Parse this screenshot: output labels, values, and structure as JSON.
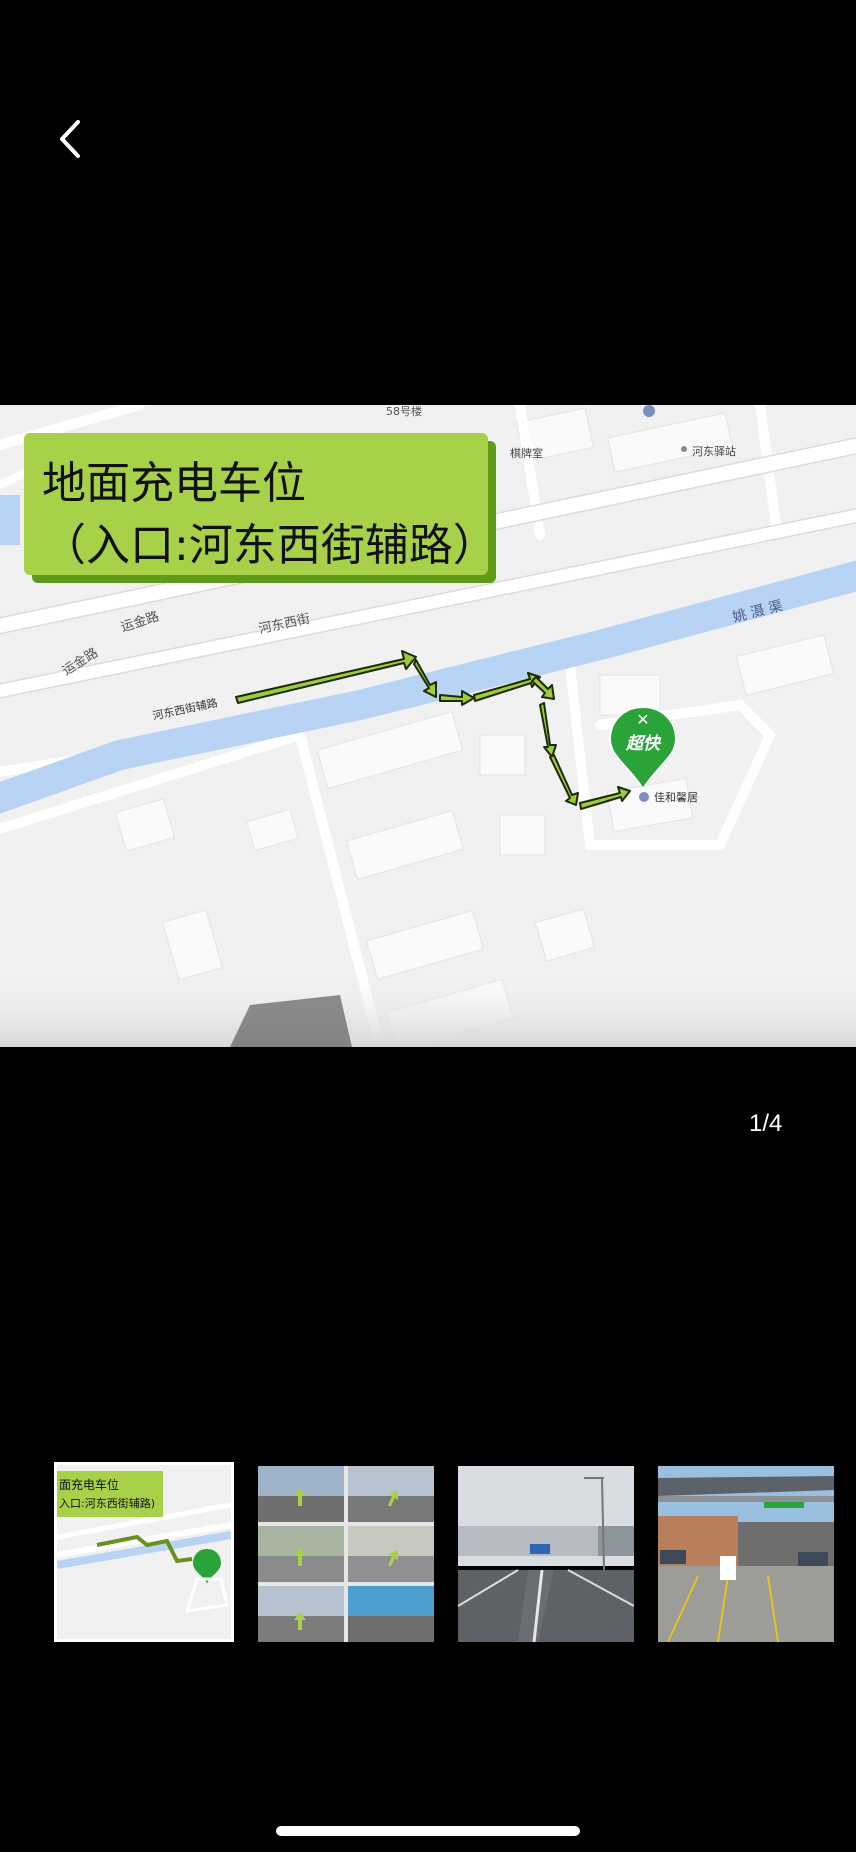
{
  "nav": {
    "back_icon": "chevron-left-icon"
  },
  "main_image": {
    "label_line1": "地面充电车位",
    "label_line2": "（入口:河东西街辅路）",
    "pin_label": "超快",
    "map_labels": {
      "building_58": "58号楼",
      "qipaishi": "棋牌室",
      "hedong_yizhan": "河东驿站",
      "yunjin_lu_1": "运金路",
      "yunjin_lu_2": "运金路",
      "hedong_xijie": "河东西街",
      "hedong_xijie_fulu": "河东西街辅路",
      "yaoyu_qu": "姚 滠 渠",
      "jiahe_xinju": "佳和馨居"
    }
  },
  "pager": {
    "indicator": "1/4"
  },
  "thumbnails": [
    {
      "id": "thumb-1",
      "kind": "map",
      "line1": "面充电车位",
      "line2": "入口:河东西街辅路)",
      "selected": true
    },
    {
      "id": "thumb-2",
      "kind": "grid",
      "selected": false
    },
    {
      "id": "thumb-3",
      "kind": "road",
      "selected": false
    },
    {
      "id": "thumb-4",
      "kind": "carport",
      "selected": false
    }
  ],
  "colors": {
    "background": "#000000",
    "label_green": "#a8d14a",
    "label_shadow": "#5f9a1a",
    "river_blue": "#b9d3f5",
    "pin_green": "#2aa338",
    "arrow_green": "#9ccc3c"
  }
}
